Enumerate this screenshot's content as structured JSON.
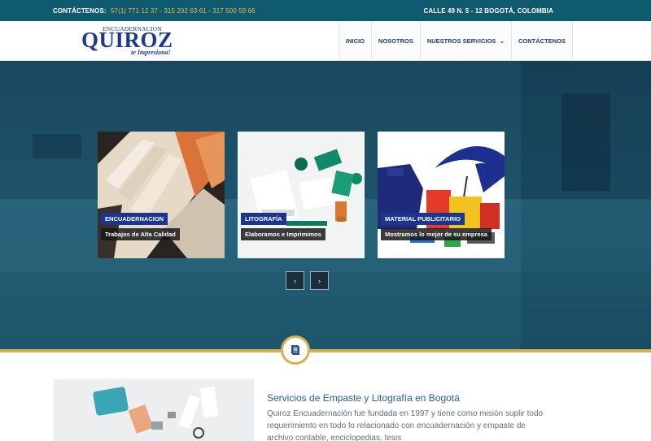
{
  "topbar": {
    "contact_label": "CONTÁCTENOS:",
    "phones": "57(1) 771 12 37 - 315 202 63 61 - 317 500 59 66",
    "address": "CALLE 49 N. 5 - 12 BOGOTÁ, COLOMBIA"
  },
  "logo": {
    "small_text": "ENCUADERNACION",
    "name": "QUIROZ",
    "tagline": "te Impresiona!"
  },
  "nav": {
    "items": [
      {
        "label": "INICIO"
      },
      {
        "label": "NOSOTROS"
      },
      {
        "label": "NUESTROS SERVICIOS"
      },
      {
        "label": "CONTÁCTENOS"
      }
    ]
  },
  "slider": {
    "cards": [
      {
        "title": "ENCUADERNACION",
        "subtitle": "Trabajos de Alta Calidad"
      },
      {
        "title": "LITOGRAFÍA",
        "subtitle": "Elaboramos e Imprimimos"
      },
      {
        "title": "MATERIAL PUBLICITARIO",
        "subtitle": "Mostramos lo mejor de su empresa"
      }
    ],
    "prev_icon": "chevron-left-icon",
    "next_icon": "chevron-right-icon",
    "prev_glyph": "‹",
    "next_glyph": "›"
  },
  "divider": {
    "icon": "book-icon"
  },
  "about": {
    "title": "Servicios de Empaste y Litografía en Bogotá",
    "text": "Quiroz Encuadernación fue fundada en 1997 y tiene como misión suplir todo requerimiento en todo lo relacionado con encuadernación y empaste de archivo contable, enciclopedias, tesis"
  },
  "colors": {
    "topbar": "#0f5a6e",
    "accent_gold": "#d8b24c",
    "brand_blue": "#1d3a8a",
    "label_blue": "#1c3590"
  }
}
